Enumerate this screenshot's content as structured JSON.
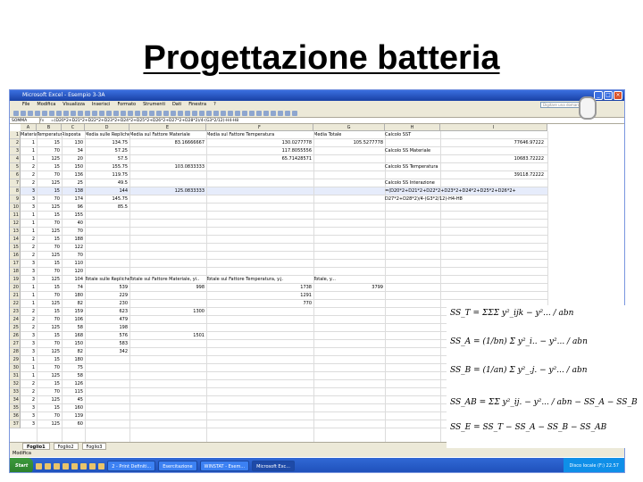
{
  "slide": {
    "title": "Progettazione batteria"
  },
  "window": {
    "title": "Microsoft Excel - Esempio 3-3A"
  },
  "menu": [
    "File",
    "Modifica",
    "Visualizza",
    "Inserisci",
    "Formato",
    "Strumenti",
    "Dati",
    "Finestra",
    "?"
  ],
  "help_box": {
    "placeholder": "Digitare una domanda"
  },
  "formula_bar": {
    "name_box": "SOMMA",
    "formula": "=(D20*2+D21*2+D22*2+D23*2+D24*2+D25*2+D26*2+D27*2+D28*2)/4-(G3*2/12)-H4-H8"
  },
  "columns": [
    "A",
    "B",
    "C",
    "D",
    "E",
    "F",
    "G",
    "H",
    "I"
  ],
  "rows": [
    [
      "Materiale",
      "Temperatura",
      "Risposta",
      "Media sulle Repliche",
      "Media sul Fattore Materiale",
      "Media sul Fattore Temperatura",
      "Media Totale",
      "Calcolo SST",
      ""
    ],
    [
      "1",
      "15",
      "130",
      "134.75",
      "83.16666667",
      "130.0277778",
      "105.5277778",
      "77646.97222",
      ""
    ],
    [
      "1",
      "70",
      "34",
      "57.25",
      "",
      "117.8055556",
      "",
      "Calcolo SS Materiale",
      ""
    ],
    [
      "1",
      "125",
      "20",
      "57.5",
      "",
      "65.71428571",
      "",
      "10683.72222",
      ""
    ],
    [
      "2",
      "15",
      "150",
      "155.75",
      "103.0833333",
      "",
      "",
      "Calcolo SS Temperatura",
      ""
    ],
    [
      "2",
      "70",
      "136",
      "119.75",
      "",
      "",
      "",
      "39118.72222",
      ""
    ],
    [
      "2",
      "125",
      "25",
      "49.5",
      "",
      "",
      "",
      "Calcolo SS Interazione",
      ""
    ],
    [
      "3",
      "15",
      "138",
      "144",
      "125.0833333",
      "",
      "",
      "=(D20*2+D21*2+D22*2+D23*2+D24*2+D25*2+D26*2+",
      ""
    ],
    [
      "3",
      "70",
      "174",
      "145.75",
      "",
      "",
      "",
      "D27*2+D28*2)/4-(G3*2/12)-H4-H8",
      ""
    ],
    [
      "3",
      "125",
      "96",
      "85.5",
      "",
      "",
      "",
      "",
      ""
    ],
    [
      "1",
      "15",
      "155",
      "",
      "",
      "",
      "",
      "",
      ""
    ],
    [
      "1",
      "70",
      "40",
      "",
      "",
      "",
      "",
      "",
      ""
    ],
    [
      "1",
      "125",
      "70",
      "",
      "",
      "",
      "",
      "",
      ""
    ],
    [
      "2",
      "15",
      "188",
      "",
      "",
      "",
      "",
      "",
      ""
    ],
    [
      "2",
      "70",
      "122",
      "",
      "",
      "",
      "",
      "",
      ""
    ],
    [
      "2",
      "125",
      "70",
      "",
      "",
      "",
      "",
      "",
      ""
    ],
    [
      "3",
      "15",
      "110",
      "",
      "",
      "",
      "",
      "",
      ""
    ],
    [
      "3",
      "70",
      "120",
      "",
      "",
      "",
      "",
      "",
      ""
    ],
    [
      "3",
      "125",
      "104",
      "Totale sulle Repliche",
      "Totale sul Fattore Materiale, yi..",
      "Totale sul Fattore Temperatura, y.j.",
      "Totale, y...",
      ""
    ],
    [
      "1",
      "15",
      "74",
      "539",
      "998",
      "1738",
      "3799",
      "",
      ""
    ],
    [
      "1",
      "70",
      "180",
      "229",
      "",
      "1291",
      "",
      "",
      ""
    ],
    [
      "1",
      "125",
      "82",
      "230",
      "",
      "770",
      "",
      "",
      ""
    ],
    [
      "2",
      "15",
      "159",
      "623",
      "1300",
      "",
      "",
      "",
      ""
    ],
    [
      "2",
      "70",
      "106",
      "479",
      "",
      "",
      "",
      "",
      ""
    ],
    [
      "2",
      "125",
      "58",
      "198",
      "",
      "",
      "",
      "",
      ""
    ],
    [
      "3",
      "15",
      "168",
      "576",
      "1501",
      "",
      "",
      "",
      ""
    ],
    [
      "3",
      "70",
      "150",
      "583",
      "",
      "",
      "",
      "",
      ""
    ],
    [
      "3",
      "125",
      "82",
      "342",
      "",
      "",
      "",
      "",
      ""
    ],
    [
      "1",
      "15",
      "180",
      "",
      "",
      "",
      "",
      "",
      ""
    ],
    [
      "1",
      "70",
      "75",
      "",
      "",
      "",
      "",
      "",
      ""
    ],
    [
      "1",
      "125",
      "58",
      "",
      "",
      "",
      "",
      "",
      ""
    ],
    [
      "2",
      "15",
      "126",
      "",
      "",
      "",
      "",
      "",
      ""
    ],
    [
      "2",
      "70",
      "115",
      "",
      "",
      "",
      "",
      "",
      ""
    ],
    [
      "2",
      "125",
      "45",
      "",
      "",
      "",
      "",
      "",
      ""
    ],
    [
      "3",
      "15",
      "160",
      "",
      "",
      "",
      "",
      "",
      ""
    ],
    [
      "3",
      "70",
      "139",
      "",
      "",
      "",
      "",
      "",
      ""
    ],
    [
      "3",
      "125",
      "60",
      "",
      "",
      "",
      "",
      "",
      ""
    ]
  ],
  "sheet_tabs": [
    "Foglio1",
    "Foglio2",
    "Foglio3"
  ],
  "status": "Modifica",
  "taskbar": {
    "start": "Start",
    "tasks": [
      "2 - Print Definiti...",
      "Esercitazione",
      "WINSTAT - Esem...",
      "Microsoft Exc..."
    ],
    "tray": "Disco locale (F:)  22.57"
  },
  "formulas": [
    "SS_T = ΣΣΣ y²_ijk − y²... / abn",
    "SS_A = (1/bn) Σ y²_i.. − y²... / abn",
    "SS_B = (1/an) Σ y²_.j. − y²... / abn",
    "SS_AB = ΣΣ y²_ij. − y²... / abn − SS_A − SS_B",
    "SS_E = SS_T − SS_A − SS_B − SS_AB"
  ]
}
